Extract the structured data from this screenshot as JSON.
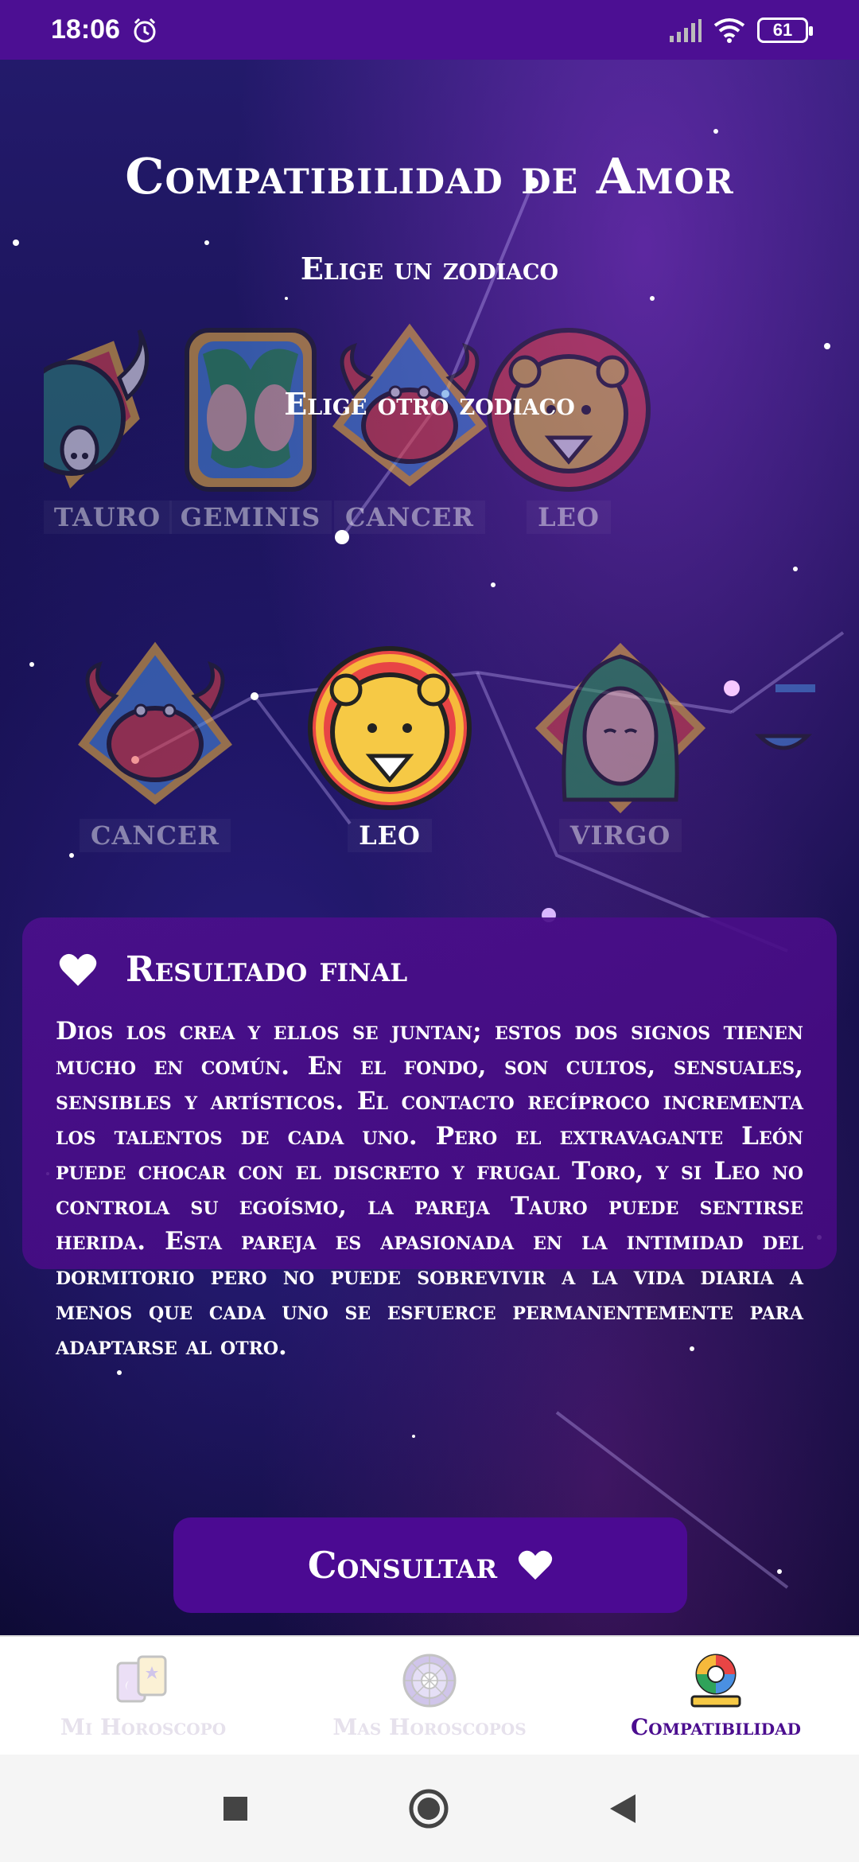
{
  "status_bar": {
    "time": "18:06",
    "battery": "61"
  },
  "page": {
    "title": "Compatibilidad de Amor",
    "subtitle_first": "Elige un zodiaco",
    "subtitle_second": "Elige otro zodiaco"
  },
  "first_carousel": {
    "items": [
      {
        "label": "TAURO",
        "icon": "taurus-icon"
      },
      {
        "label": "GEMINIS",
        "icon": "gemini-icon"
      },
      {
        "label": "CANCER",
        "icon": "cancer-icon"
      },
      {
        "label": "LEO",
        "icon": "leo-icon"
      }
    ]
  },
  "second_carousel": {
    "items": [
      {
        "label": "CANCER",
        "icon": "cancer-icon"
      },
      {
        "label": "LEO",
        "icon": "leo-icon",
        "selected": true
      },
      {
        "label": "VIRGO",
        "icon": "virgo-icon"
      },
      {
        "label": "",
        "icon": "libra-icon"
      }
    ]
  },
  "result": {
    "title": "Resultado final",
    "text": "Dios los crea y ellos se juntan; estos dos signos tienen mucho en común. En el fondo, son cultos, sensuales, sensibles y artísticos. El contacto recíproco incrementa los talentos de cada uno. Pero el extravagante León puede chocar con el discreto y frugal Toro, y si Leo no controla su egoísmo, la pareja Tauro puede sentirse herida. Esta pareja es apasionada en la intimidad del dormitorio pero no puede sobrevivir a la vida diaria a menos que cada uno se esfuerce permanentemente para adaptarse al otro."
  },
  "consult_button": {
    "label": "Consultar"
  },
  "bottom_nav": {
    "items": [
      {
        "label": "Mi Horoscopo",
        "icon": "tarot-cards-icon"
      },
      {
        "label": "Mas Horoscopos",
        "icon": "zodiac-wheel-icon"
      },
      {
        "label": "Compatibilidad",
        "icon": "compatibility-icon",
        "active": true
      }
    ]
  },
  "colors": {
    "accent": "#4b0a92",
    "status_bar": "#4c0f93"
  }
}
